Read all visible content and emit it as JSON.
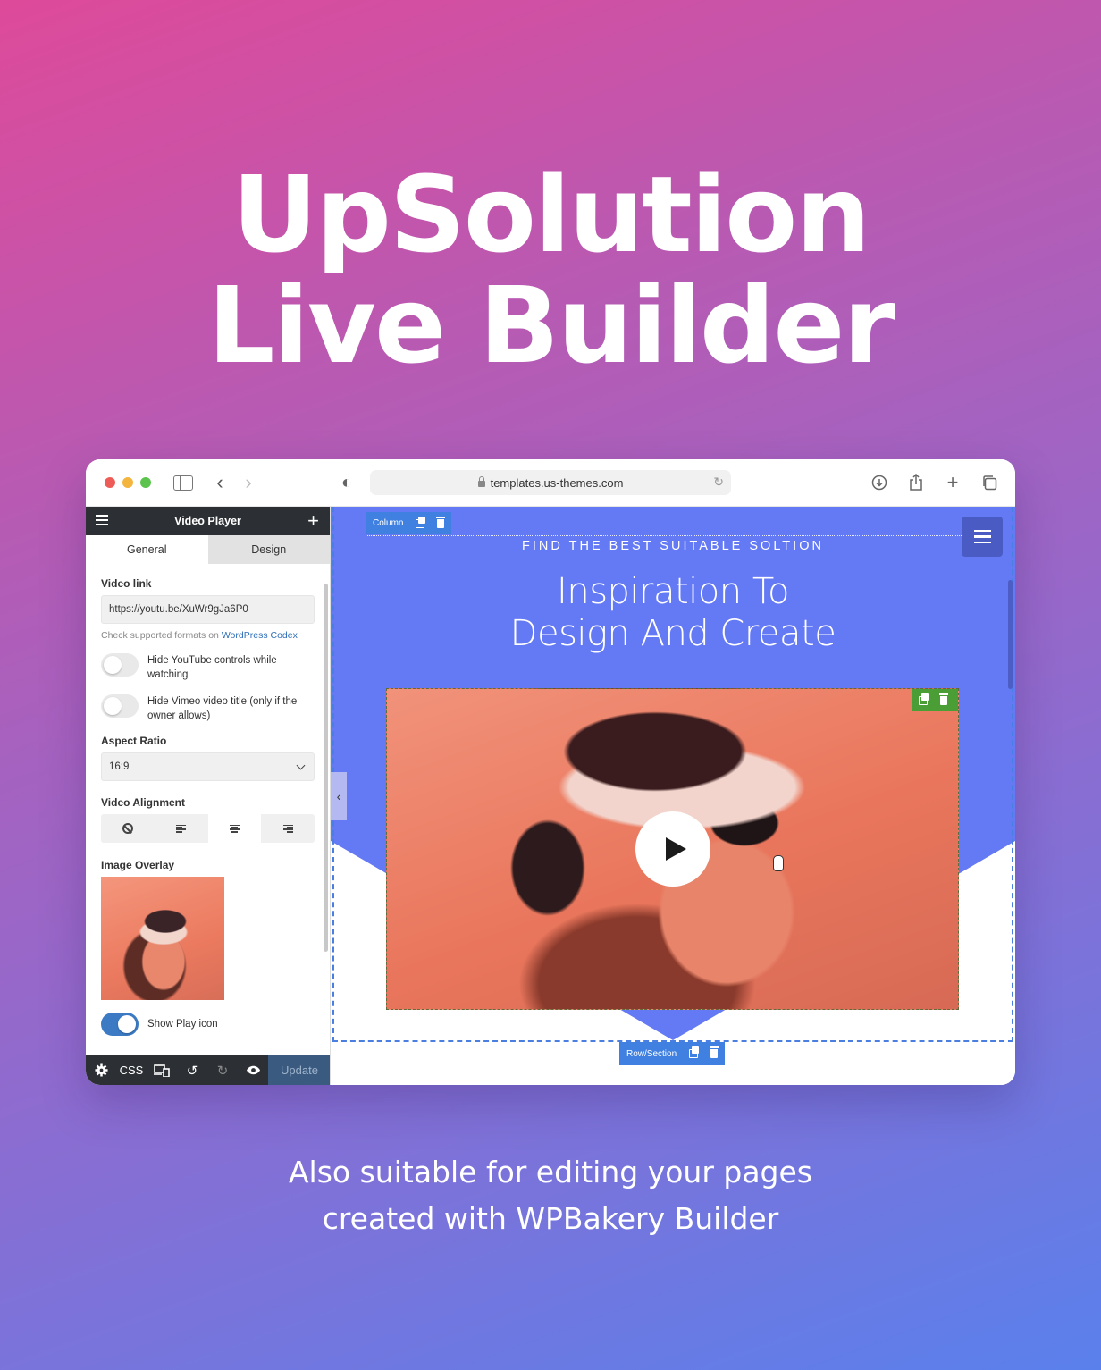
{
  "hero": {
    "title_line1": "UpSolution",
    "title_line2": "Live Builder",
    "subtitle_line1": "Also suitable for editing your pages",
    "subtitle_line2": "created with WPBakery Builder"
  },
  "browser": {
    "url": "templates.us-themes.com",
    "icons": [
      "sidebar-toggle-icon",
      "back-icon",
      "forward-icon",
      "shield-icon",
      "lock-icon",
      "reload-icon",
      "download-icon",
      "share-icon",
      "new-tab-icon",
      "tabs-overview-icon"
    ],
    "back_glyph": "‹",
    "forward_glyph": "›",
    "reload_glyph": "↻",
    "download_glyph": "⊕",
    "share_glyph": "⇪",
    "newtab_glyph": "+",
    "tabs_glyph": "❐",
    "shield_glyph": "◐"
  },
  "panel": {
    "title": "Video Player",
    "add_glyph": "+",
    "tabs": [
      {
        "label": "General",
        "active": true
      },
      {
        "label": "Design",
        "active": false
      }
    ],
    "video_link": {
      "label": "Video link",
      "value": "https://youtu.be/XuWr9gJa6P0",
      "hint_text": "Check supported formats on ",
      "hint_link": "WordPress Codex"
    },
    "toggles": [
      {
        "label": "Hide YouTube controls while watching",
        "on": false
      },
      {
        "label": "Hide Vimeo video title (only if the owner allows)",
        "on": false
      }
    ],
    "aspect_ratio": {
      "label": "Aspect Ratio",
      "value": "16:9"
    },
    "video_alignment": {
      "label": "Video Alignment",
      "options": [
        "none",
        "left",
        "center",
        "right"
      ],
      "selected": "center"
    },
    "image_overlay": {
      "label": "Image Overlay"
    },
    "show_play_icon": {
      "label": "Show Play icon",
      "on": true
    },
    "footer": {
      "css_label": "CSS",
      "update_label": "Update",
      "icons": [
        "settings-icon",
        "css",
        "responsive-icon",
        "undo-icon",
        "redo-icon",
        "preview-icon"
      ]
    }
  },
  "canvas": {
    "column_label": "Column",
    "row_label": "Row/Section",
    "kicker": "FIND THE BEST SUITABLE SOLTION",
    "headline_line1": "Inspiration To",
    "headline_line2": "Design And Create",
    "collapse_glyph": "‹",
    "colors": {
      "section_bg": "#6479f4",
      "edit_bar": "#3f80e0",
      "element_bar": "#4b9e35",
      "menu_button": "#4a5cc4"
    }
  }
}
